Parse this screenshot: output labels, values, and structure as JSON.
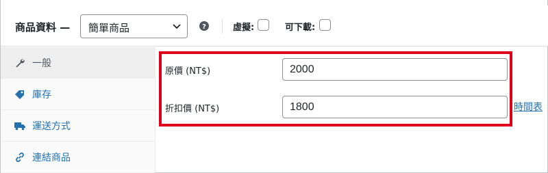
{
  "header": {
    "title": "商品資料 —",
    "product_type": "簡單商品",
    "virtual_label": "虛擬:",
    "downloadable_label": "可下載:"
  },
  "sidebar": {
    "items": [
      {
        "label": "一般",
        "icon": "wrench-icon",
        "active": true
      },
      {
        "label": "庫存",
        "icon": "tag-icon",
        "active": false
      },
      {
        "label": "運送方式",
        "icon": "truck-icon",
        "active": false
      },
      {
        "label": "連結商品",
        "icon": "link-icon",
        "active": false
      }
    ]
  },
  "fields": {
    "regular_price_label": "原價 (NT$)",
    "regular_price_value": "2000",
    "sale_price_label": "折扣價 (NT$)",
    "sale_price_value": "1800",
    "schedule_link": "時間表"
  },
  "colors": {
    "accent": "#2271b1",
    "highlight": "#e0001b"
  }
}
